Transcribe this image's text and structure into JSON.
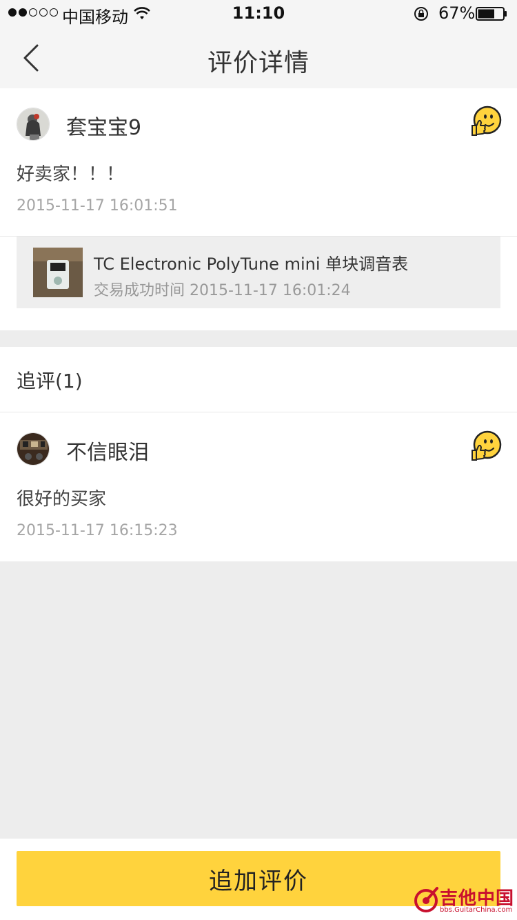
{
  "status_bar": {
    "carrier": "中国移动",
    "time": "11:10",
    "battery_percent": "67%",
    "signal_strength": 2,
    "signal_total": 5,
    "battery_level": 0.67
  },
  "nav": {
    "title": "评价详情",
    "back_icon": "chevron-left-icon"
  },
  "review": {
    "username": "套宝宝9",
    "text": "好卖家！！！",
    "time": "2015-11-17 16:01:51",
    "emoji_icon": "thumbs-up-face-icon",
    "order": {
      "name": "TC Electronic PolyTune mini 单块调音表",
      "time": "交易成功时间 2015-11-17 16:01:24"
    }
  },
  "followup": {
    "header": "追评(1)",
    "items": [
      {
        "username": "不信眼泪",
        "text": "很好的买家",
        "time": "2015-11-17 16:15:23",
        "emoji_icon": "thumbs-up-face-icon"
      }
    ]
  },
  "actions": {
    "add_review_label": "追加评价"
  },
  "watermark": {
    "text": "吉他中国",
    "sub": "bbs.GuitarChina.com"
  },
  "colors": {
    "accent": "#ffd33d",
    "page_bg": "#ededed",
    "muted_text": "#a5a5a5"
  }
}
